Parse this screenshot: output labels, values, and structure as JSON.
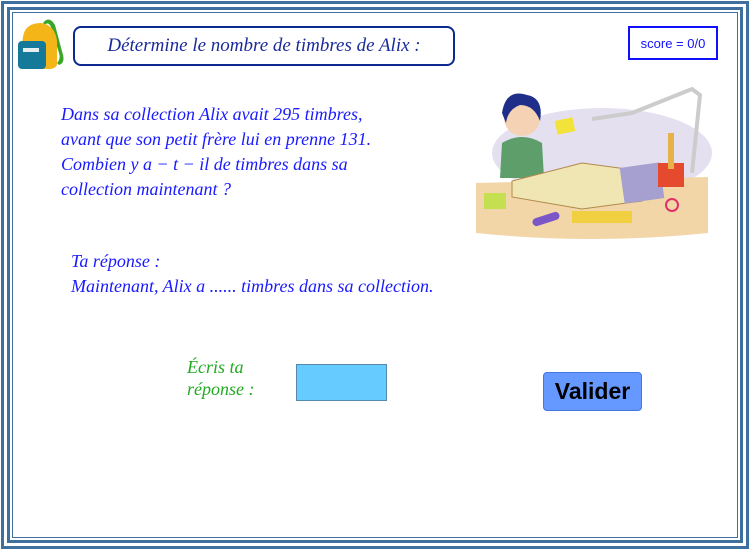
{
  "header": {
    "title": "Détermine le nombre de timbres de Alix :",
    "score": "score = 0/0"
  },
  "problem": {
    "lines": [
      "Dans sa collection Alix avait 295 timbres,",
      "avant que son petit frère lui en prenne 131.",
      "Combien y a − t − il de timbres dans sa",
      "collection maintenant ?"
    ]
  },
  "answer": {
    "label": "Ta réponse :",
    "sentence": "Maintenant, Alix a ...... timbres dans sa collection."
  },
  "input": {
    "label_line1": "Écris ta",
    "label_line2": "réponse :",
    "value": ""
  },
  "validate_label": "Valider",
  "colors": {
    "frame": "#3f6f9f",
    "text": "#1a1aff",
    "green": "#22aa22",
    "input": "#66ccff",
    "button": "#6699ff"
  }
}
